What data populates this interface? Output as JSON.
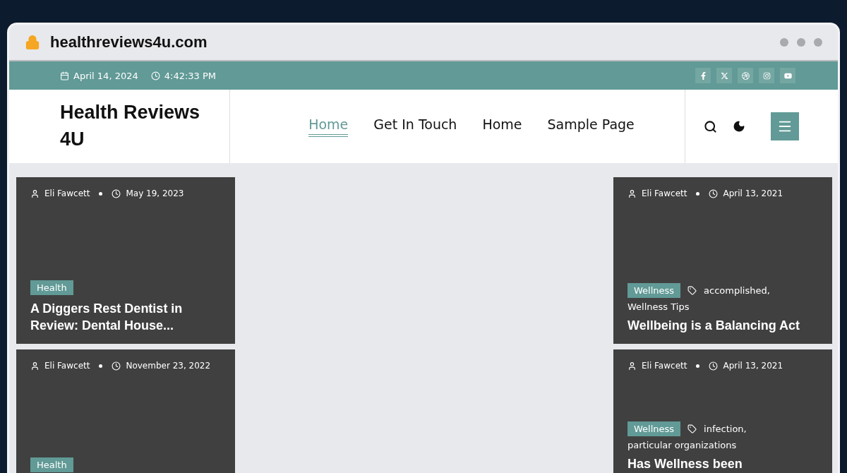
{
  "browser": {
    "url": "healthreviews4u.com"
  },
  "top_bar": {
    "date": "April 14, 2024",
    "time": "4:42:33 PM",
    "social": [
      {
        "kind": "facebook"
      },
      {
        "kind": "x"
      },
      {
        "kind": "dribbble"
      },
      {
        "kind": "instagram"
      },
      {
        "kind": "youtube"
      }
    ]
  },
  "header": {
    "site_title": "Health Reviews 4U",
    "nav": [
      {
        "label": "Home",
        "selected": true
      },
      {
        "label": "Get In Touch",
        "selected": false
      },
      {
        "label": "Home",
        "selected": false
      },
      {
        "label": "Sample Page",
        "selected": false
      }
    ]
  },
  "left_posts": [
    {
      "author": "Eli Fawcett",
      "date": "May 19, 2023",
      "category": "Health",
      "title": "A Diggers Rest Dentist in Review: Dental House..."
    },
    {
      "author": "Eli Fawcett",
      "date": "November 23, 2022",
      "category": "Health"
    }
  ],
  "right_posts": [
    {
      "author": "Eli Fawcett",
      "date": "April 13, 2021",
      "category": "Wellness",
      "tags": [
        "accomplished,",
        "Wellness Tips"
      ],
      "title": "Wellbeing is a Balancing Act"
    },
    {
      "author": "Eli Fawcett",
      "date": "April 13, 2021",
      "category": "Wellness",
      "tags": [
        "infection,",
        "particular organizations"
      ],
      "title": "Has Wellness been"
    }
  ]
}
